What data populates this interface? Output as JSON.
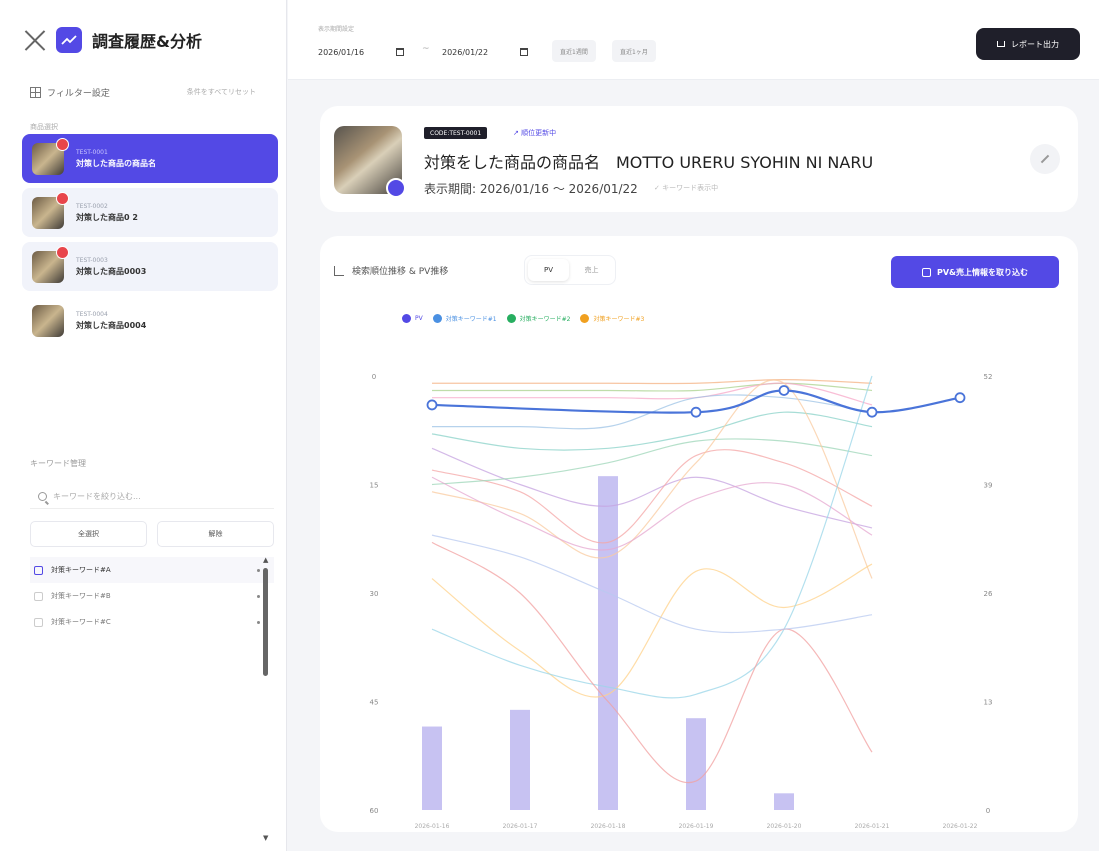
{
  "sidebar": {
    "app_title": "調査履歴&分析",
    "filter_label": "フィルター設定",
    "filter_reset": "条件をすべてリセット",
    "products_label": "商品選択",
    "products": [
      {
        "code": "TEST-0001",
        "name": "対策した商品の商品名",
        "badge": true,
        "active": true
      },
      {
        "code": "TEST-0002",
        "name": "対策した商品0 2",
        "badge": true,
        "active": false
      },
      {
        "code": "TEST-0003",
        "name": "対策した商品0003",
        "badge": true,
        "active": false
      },
      {
        "code": "TEST-0004",
        "name": "対策した商品0004",
        "badge": false,
        "active": false
      }
    ],
    "keyword_section_label": "キーワード管理",
    "keyword_search_placeholder": "キーワードを絞り込む...",
    "select_all": "全選択",
    "clear": "解除",
    "keywords": [
      {
        "label": "対策キーワード#A",
        "checked": true
      },
      {
        "label": "対策キーワード#B",
        "checked": false
      },
      {
        "label": "対策キーワード#C",
        "checked": false
      }
    ]
  },
  "topbar": {
    "period_label": "表示期間設定",
    "date_from": "2026/01/16",
    "date_to": "2026/01/22",
    "tilde": "~",
    "chip_recent": "直近1週間",
    "chip_month": "直近1ヶ月",
    "export_label": "レポート出力"
  },
  "product_card": {
    "code_tag": "CODE:TEST-0001",
    "rank_update": "順位更新中",
    "title": "対策をした商品の商品名　MOTTO URERU SYOHIN NI NARU",
    "period": "表示期間: 2026/01/16 ～ 2026/01/22",
    "keyword_note": "キーワード表示中"
  },
  "chart_card": {
    "title": "検索順位推移 & PV推移",
    "toggle": [
      "PV",
      "売上"
    ],
    "import_label": "PV&売上情報を取り込む",
    "legend": [
      {
        "name": "PV",
        "color": "#5349e5"
      },
      {
        "name": "対策キーワード#1",
        "color": "#4a90e2"
      },
      {
        "name": "対策キーワード#2",
        "color": "#27ae60"
      },
      {
        "name": "対策キーワード#3",
        "color": "#f0a020"
      }
    ]
  },
  "chart_data": {
    "type": "line",
    "x": [
      "2026-01-16",
      "2026-01-17",
      "2026-01-18",
      "2026-01-19",
      "2026-01-20",
      "2026-01-21",
      "2026-01-22"
    ],
    "ylim": [
      60,
      0
    ],
    "y_ticks": [
      "0",
      "15",
      "30",
      "45",
      "60"
    ],
    "y2_ticks": [
      "0",
      "13",
      "26",
      "39",
      "52"
    ],
    "y2lim": [
      0,
      52
    ],
    "pv_bars": [
      10,
      12,
      40,
      11,
      2,
      0,
      0
    ],
    "highlight": {
      "color": "#4a74d9",
      "x_index": [
        0,
        3,
        4,
        5,
        6
      ],
      "values": [
        4,
        5,
        2,
        5,
        3
      ]
    },
    "series": [
      {
        "color": "#f4b183",
        "values": [
          1,
          1,
          1,
          1,
          0.5,
          1
        ]
      },
      {
        "color": "#a9d18e",
        "values": [
          2,
          2,
          2,
          2,
          1,
          2
        ]
      },
      {
        "color": "#f7a8c8",
        "values": [
          3,
          3,
          3,
          3,
          1,
          4
        ]
      },
      {
        "color": "#9dc3e6",
        "values": [
          7,
          7,
          7,
          3,
          3,
          5
        ]
      },
      {
        "color": "#8ad2c8",
        "values": [
          8,
          10,
          10,
          8,
          5,
          7
        ]
      },
      {
        "color": "#c5a3e0",
        "values": [
          10,
          15,
          18,
          14,
          18,
          21
        ]
      },
      {
        "color": "#f4a6a6",
        "values": [
          13,
          16,
          23,
          11,
          12,
          18
        ]
      },
      {
        "color": "#9dd6b8",
        "values": [
          15,
          14,
          12,
          9,
          9,
          11
        ]
      },
      {
        "color": "#f9cba0",
        "values": [
          16,
          19,
          25,
          12,
          1,
          28
        ]
      },
      {
        "color": "#e6a8d0",
        "values": [
          14,
          20,
          24,
          17,
          15,
          22
        ]
      },
      {
        "color": "#ffd28a",
        "values": [
          28,
          38,
          44,
          27,
          32,
          26
        ]
      },
      {
        "color": "#99d5e8",
        "values": [
          35,
          40,
          43,
          44,
          35,
          0
        ]
      },
      {
        "color": "#f2a0a0",
        "values": [
          23,
          30,
          45,
          56,
          35,
          52
        ]
      },
      {
        "color": "#b8c9f0",
        "values": [
          22,
          25,
          30,
          35,
          35,
          33
        ]
      }
    ]
  }
}
